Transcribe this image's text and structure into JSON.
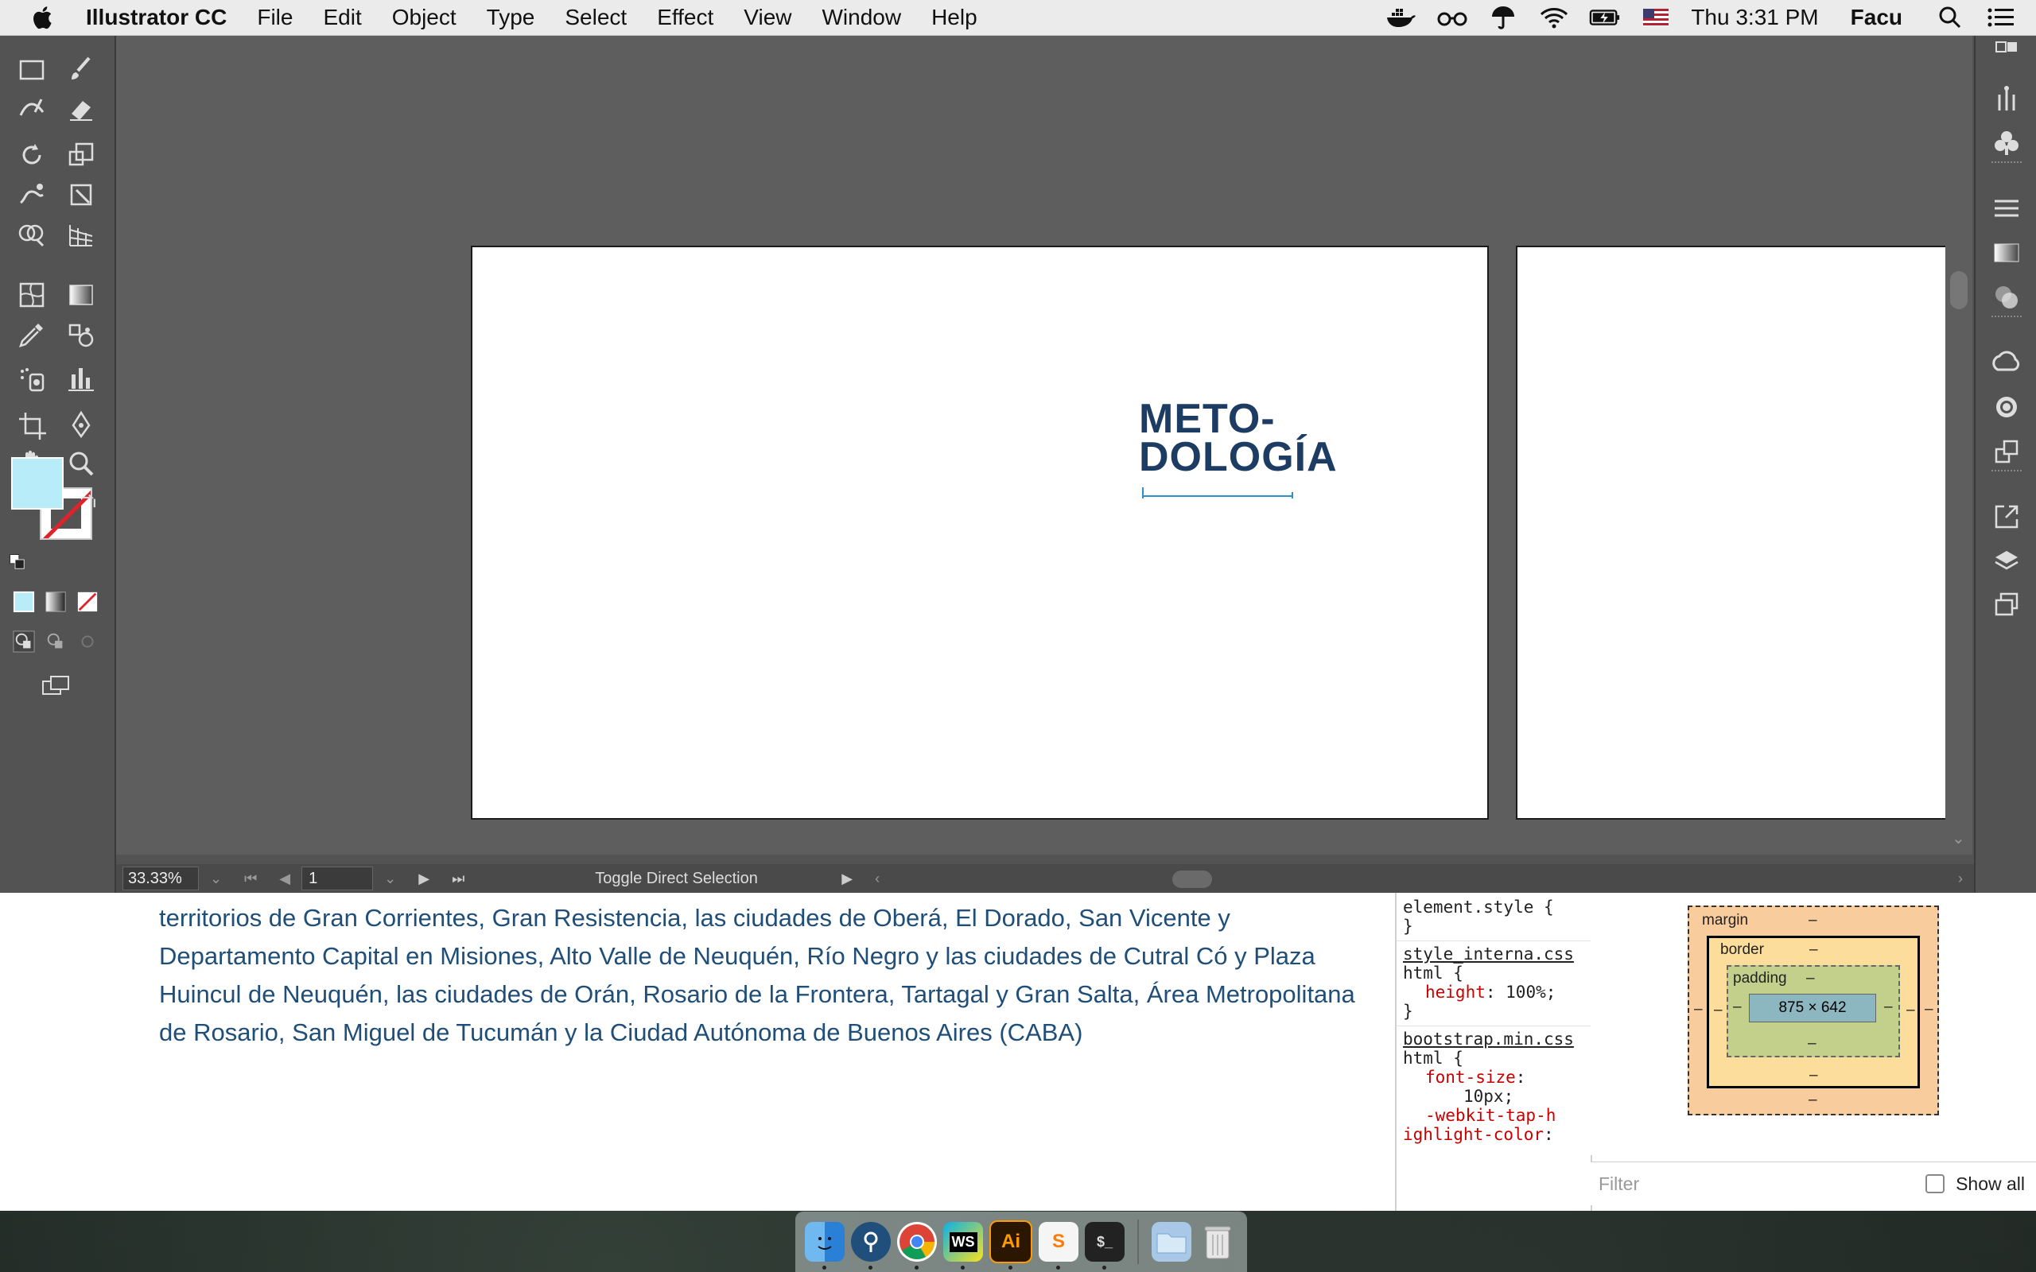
{
  "menubar": {
    "app_name": "Illustrator CC",
    "menus": [
      "File",
      "Edit",
      "Object",
      "Type",
      "Select",
      "Effect",
      "View",
      "Window",
      "Help"
    ],
    "clock": "Thu 3:31 PM",
    "user": "Facu"
  },
  "artboard": {
    "logo_line1": "METO-",
    "logo_line2": "DOLOGÍA",
    "logo_color": "#1c3c64",
    "selection_color": "#2d8fd0"
  },
  "toolbox": {
    "fill_color": "#b7ecf8",
    "stroke_color": "none"
  },
  "statusbar": {
    "zoom": "33.33%",
    "artboard_number": "1",
    "status_label": "Toggle Direct Selection"
  },
  "browser": {
    "paragraph": "territorios de Gran Corrientes, Gran Resistencia, las ciudades de Oberá, El Dorado, San Vicente y Departamento Capital en Misiones, Alto Valle de Neuquén, Río Negro y las ciudades de Cutral Có y Plaza Huincul de Neuquén, las ciudades de Orán, Rosario de la Frontera, Tartagal y Gran Salta, Área Metropolitana de Rosario, San Miguel de Tucumán y la Ciudad Autónoma de Buenos Aires (CABA)",
    "text_color": "#1f4e79"
  },
  "devtools": {
    "rule1_selector": "element.style {",
    "rule1_close": "}",
    "rule2_source": "style_interna.css",
    "rule2_selector": "html {",
    "rule2_prop": "height",
    "rule2_value": "100%;",
    "rule2_close": "}",
    "rule3_source": "bootstrap.min.css",
    "rule3_selector": "html {",
    "rule3_prop1": "font-size",
    "rule3_value1": "10px;",
    "rule3_prop2": "-webkit-tap-highlight-color",
    "box_model": {
      "margin_label": "margin",
      "border_label": "border",
      "padding_label": "padding",
      "dash": "–",
      "content_size": "875 × 642"
    },
    "filter_placeholder": "Filter",
    "show_all_label": "Show all"
  },
  "dock": {
    "apps": [
      "Finder",
      "Sourcetree",
      "Chrome",
      "WebStorm",
      "Illustrator",
      "Sublime",
      "Terminal",
      "Downloads",
      "Trash"
    ],
    "ws_label": "WS",
    "ai_label": "Ai",
    "s_label": "S",
    "term_label": "$_"
  }
}
